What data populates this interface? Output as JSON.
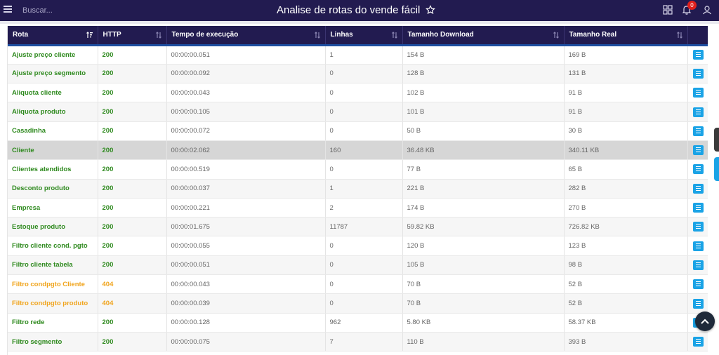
{
  "header": {
    "title": "Analise de rotas do vende fácil",
    "search_placeholder": "Buscar...",
    "notification_count": "0"
  },
  "table": {
    "columns": [
      "Rota",
      "HTTP",
      "Tempo de execução",
      "Linhas",
      "Tamanho Download",
      "Tamanho Real"
    ],
    "rows": [
      {
        "rota": "Ajuste preço cliente",
        "http": "200",
        "tempo": "00:00:00.051",
        "linhas": "1",
        "download": "154 B",
        "real": "169 B"
      },
      {
        "rota": "Ajuste preço segmento",
        "http": "200",
        "tempo": "00:00:00.092",
        "linhas": "0",
        "download": "128 B",
        "real": "131 B"
      },
      {
        "rota": "Aliquota cliente",
        "http": "200",
        "tempo": "00:00:00.043",
        "linhas": "0",
        "download": "102 B",
        "real": "91 B"
      },
      {
        "rota": "Aliquota produto",
        "http": "200",
        "tempo": "00:00:00.105",
        "linhas": "0",
        "download": "101 B",
        "real": "91 B"
      },
      {
        "rota": "Casadinha",
        "http": "200",
        "tempo": "00:00:00.072",
        "linhas": "0",
        "download": "50 B",
        "real": "30 B"
      },
      {
        "rota": "Cliente",
        "http": "200",
        "tempo": "00:00:02.062",
        "linhas": "160",
        "download": "36.48 KB",
        "real": "340.11 KB"
      },
      {
        "rota": "Clientes atendidos",
        "http": "200",
        "tempo": "00:00:00.519",
        "linhas": "0",
        "download": "77 B",
        "real": "65 B"
      },
      {
        "rota": "Desconto produto",
        "http": "200",
        "tempo": "00:00:00.037",
        "linhas": "1",
        "download": "221 B",
        "real": "282 B"
      },
      {
        "rota": "Empresa",
        "http": "200",
        "tempo": "00:00:00.221",
        "linhas": "2",
        "download": "174 B",
        "real": "270 B"
      },
      {
        "rota": "Estoque produto",
        "http": "200",
        "tempo": "00:00:01.675",
        "linhas": "11787",
        "download": "59.82 KB",
        "real": "726.82 KB"
      },
      {
        "rota": "Filtro cliente cond. pgto",
        "http": "200",
        "tempo": "00:00:00.055",
        "linhas": "0",
        "download": "120 B",
        "real": "123 B"
      },
      {
        "rota": "Filtro cliente tabela",
        "http": "200",
        "tempo": "00:00:00.051",
        "linhas": "0",
        "download": "105 B",
        "real": "98 B"
      },
      {
        "rota": "Filtro condpgto Cliente",
        "http": "404",
        "tempo": "00:00:00.043",
        "linhas": "0",
        "download": "70 B",
        "real": "52 B"
      },
      {
        "rota": "Filtro condpgto produto",
        "http": "404",
        "tempo": "00:00:00.039",
        "linhas": "0",
        "download": "70 B",
        "real": "52 B"
      },
      {
        "rota": "Filtro rede",
        "http": "200",
        "tempo": "00:00:00.128",
        "linhas": "962",
        "download": "5.80 KB",
        "real": "58.37 KB"
      },
      {
        "rota": "Filtro segmento",
        "http": "200",
        "tempo": "00:00:00.075",
        "linhas": "7",
        "download": "110 B",
        "real": "393 B"
      }
    ]
  },
  "colors": {
    "header_bg": "#221b50",
    "status_ok": "#2f8a1f",
    "status_not_found": "#f0a41c",
    "action_button": "#1aa3e6"
  }
}
